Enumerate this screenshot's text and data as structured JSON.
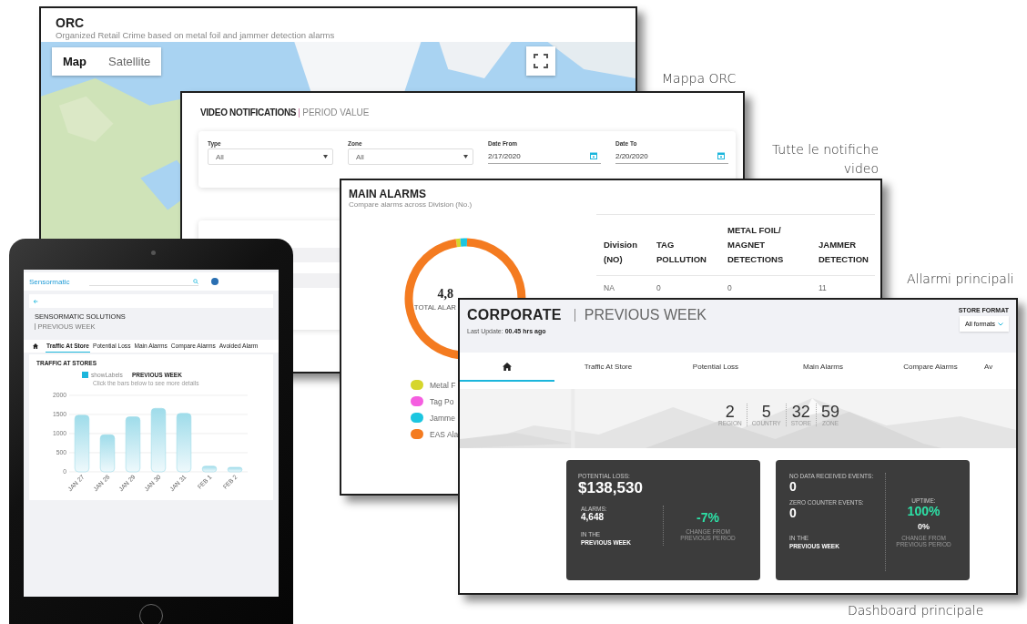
{
  "captions": [
    "Mappa ORC",
    "Tutte le notifiche video",
    "Allarmi principali",
    "Dashboard principale"
  ],
  "orc": {
    "title": "ORC",
    "subtitle": "Organized Retail Crime based on metal foil and jammer detection alarms",
    "map_types": [
      {
        "label": "Map",
        "selected": true
      },
      {
        "label": "Satellite",
        "selected": false
      }
    ]
  },
  "video": {
    "title": "VIDEO NOTIFICATIONS",
    "subtitle": "PERIOD VALUE",
    "filters": [
      {
        "kind": "select",
        "label": "Type",
        "value": "All"
      },
      {
        "kind": "select",
        "label": "Zone",
        "value": "All"
      },
      {
        "kind": "date",
        "label": "Date From",
        "value": "2/17/2020"
      },
      {
        "kind": "date",
        "label": "Date To",
        "value": "2/20/2020"
      }
    ]
  },
  "main_alarms": {
    "title": "MAIN ALARMS",
    "subtitle": "Compare alarms across Division (No.)",
    "total": "4,8",
    "total_label": "TOTAL ALAR",
    "legend": [
      {
        "label": "Metal F",
        "color": "#d6d62c"
      },
      {
        "label": "Tag Po",
        "color": "#f55ee0"
      },
      {
        "label": "Jamme",
        "color": "#1cc6e0"
      },
      {
        "label": "EAS Ala",
        "color": "#f47b20"
      }
    ],
    "table": {
      "columns": [
        "Division (NO)",
        "TAG POLLUTION",
        "METAL FOIL/ MAGNET DETECTIONS",
        "JAMMER DETECTION"
      ],
      "rows": [
        [
          "NA",
          "0",
          "0",
          "11"
        ]
      ]
    }
  },
  "tablet": {
    "logo": "Sensormatic",
    "title": "SENSORMATIC SOLUTIONS",
    "period": "PREVIOUS WEEK",
    "tabs": [
      {
        "kind": "home",
        "selected": false
      },
      {
        "kind": "text",
        "label": "Traffic At Store",
        "selected": true
      },
      {
        "kind": "text",
        "label": "Potential Loss",
        "selected": false
      },
      {
        "kind": "text",
        "label": "Main Alarms",
        "selected": false
      },
      {
        "kind": "text",
        "label": "Compare Alarms",
        "selected": false
      },
      {
        "kind": "text",
        "label": "Avoided Alarm",
        "selected": false
      }
    ],
    "section": "TRAFFIC AT STORES",
    "show_labels": {
      "label": "showLabels",
      "checked": true
    },
    "chart_heading": "PREVIOUS WEEK",
    "chart_hint": "Click the bars below to see more details",
    "chart_data": {
      "type": "bar",
      "categories": [
        "JAN 27",
        "JAN 28",
        "JAN 29",
        "JAN 30",
        "JAN 31",
        "FEB 1",
        "FEB 2"
      ],
      "series": [
        {
          "color": "#9fdcea",
          "values": [
            1480,
            970,
            1440,
            1660,
            1530,
            150,
            120
          ]
        }
      ],
      "ylim": [
        0,
        2000
      ],
      "yticks": [
        0,
        500,
        1000,
        1500,
        2000
      ],
      "grid": true
    }
  },
  "corporate": {
    "title": "CORPORATE",
    "period": "PREVIOUS WEEK",
    "last_update_label": "Last Update:",
    "last_update": "00.45 hrs ago",
    "store_format": {
      "label": "STORE FORMAT",
      "value": "All formats"
    },
    "tabs": [
      {
        "kind": "home",
        "selected": true
      },
      {
        "kind": "text",
        "label": "Traffic At Store",
        "selected": false
      },
      {
        "kind": "text",
        "label": "Potential Loss",
        "selected": false
      },
      {
        "kind": "text",
        "label": "Main Alarms",
        "selected": false
      },
      {
        "kind": "text",
        "label": "Compare Alarms",
        "selected": false
      },
      {
        "kind": "text",
        "label": "Av",
        "selected": false
      }
    ],
    "counts": [
      {
        "value": "2",
        "label": "REGION"
      },
      {
        "value": "5",
        "label": "COUNTRY"
      },
      {
        "value": "32",
        "label": "STORE"
      },
      {
        "value": "59",
        "label": "ZONE"
      }
    ],
    "loss_card": {
      "loss_label": "POTENTIAL LOSS:",
      "loss": "$138,530",
      "alarms_label": "ALARMS:",
      "alarms": "4,648",
      "period_prefix": "IN THE",
      "period": "PREVIOUS WEEK",
      "change": "-7%",
      "change_label": "CHANGE FROM PREVIOUS PERIOD"
    },
    "status_card": {
      "no_data_label": "NO DATA RECEIVED EVENTS:",
      "no_data": "0",
      "zero_label": "ZERO COUNTER EVENTS:",
      "zero": "0",
      "period_prefix": "IN THE",
      "period": "PREVIOUS WEEK",
      "uptime_label": "UPTIME:",
      "uptime": "100%",
      "uptime_change": "0%",
      "change_label": "CHANGE FROM PREVIOUS PERIOD"
    }
  }
}
